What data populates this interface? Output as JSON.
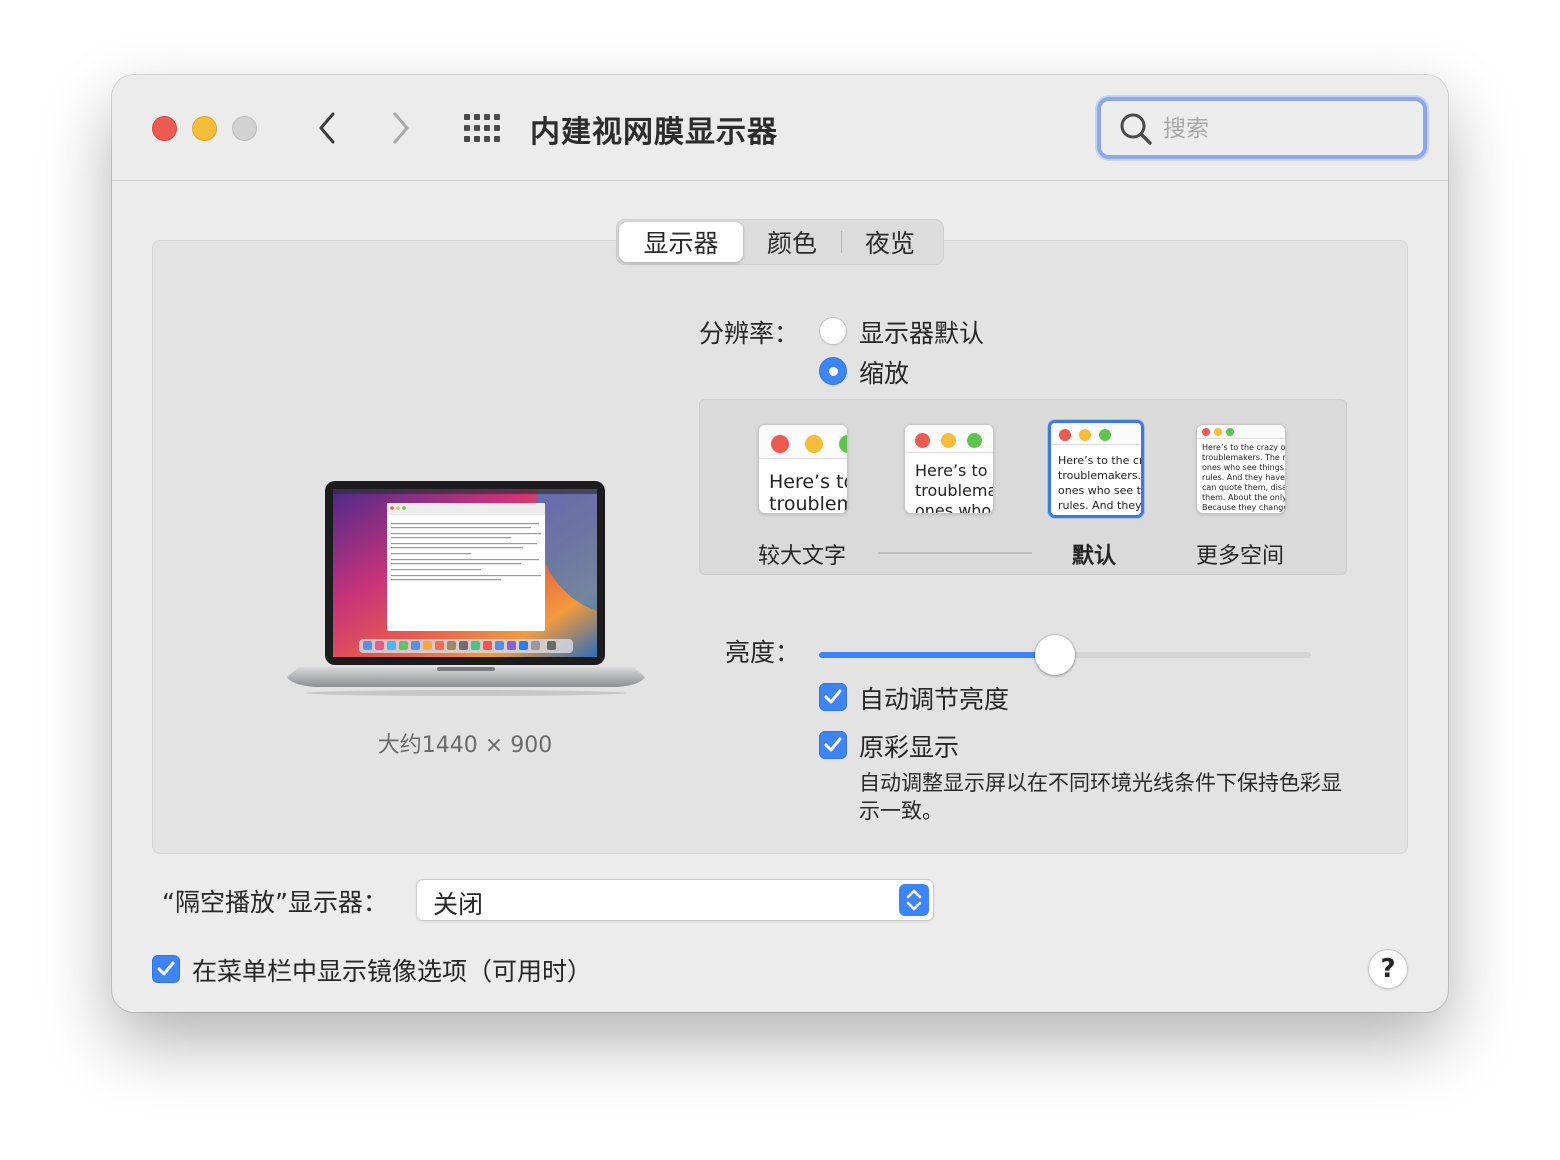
{
  "window": {
    "title": "内建视网膜显示器"
  },
  "search": {
    "placeholder": "搜索"
  },
  "tabs": [
    {
      "label": "显示器",
      "active": true
    },
    {
      "label": "颜色"
    },
    {
      "label": "夜览"
    }
  ],
  "display": {
    "approx_resolution": "大约1440 × 900",
    "resolution_label": "分辨率：",
    "resolution_options": [
      {
        "label": "显示器默认",
        "selected": false
      },
      {
        "label": "缩放",
        "selected": true
      }
    ],
    "scale_options": [
      {
        "label": "较大文字",
        "preview": [
          "Here’s to",
          "troublem"
        ]
      },
      {
        "label": "",
        "preview": [
          "Here’s to t",
          "troublema",
          "ones who"
        ]
      },
      {
        "label": "默认",
        "selected": true,
        "preview": [
          "Here’s to the cr",
          "troublemakers.",
          "ones who see t",
          "rules. And they"
        ]
      },
      {
        "label": "更多空间",
        "preview": [
          "Here’s to the crazy one",
          "troublemakers. The rou",
          "ones who see things dif",
          "rules. And they have no",
          "can quote them, disagre",
          "them. About the only th",
          "Because they change th"
        ]
      }
    ],
    "brightness_label": "亮度：",
    "brightness_level": 0.48,
    "auto_brightness": {
      "label": "自动调节亮度",
      "checked": true
    },
    "true_tone": {
      "label": "原彩显示",
      "checked": true,
      "description": "自动调整显示屏以在不同环境光线条件下保持色彩显示一致。"
    }
  },
  "airplay": {
    "label": "“隔空播放”显示器：",
    "value": "关闭"
  },
  "mirror_option": {
    "label": "在菜单栏中显示镜像选项（可用时）",
    "checked": true
  },
  "help": {
    "label": "?"
  },
  "colors": {
    "accent": "#3d84f5",
    "close": "#ee5b54",
    "minimize": "#f6bd3b",
    "zoom": "#d2d2d2"
  }
}
